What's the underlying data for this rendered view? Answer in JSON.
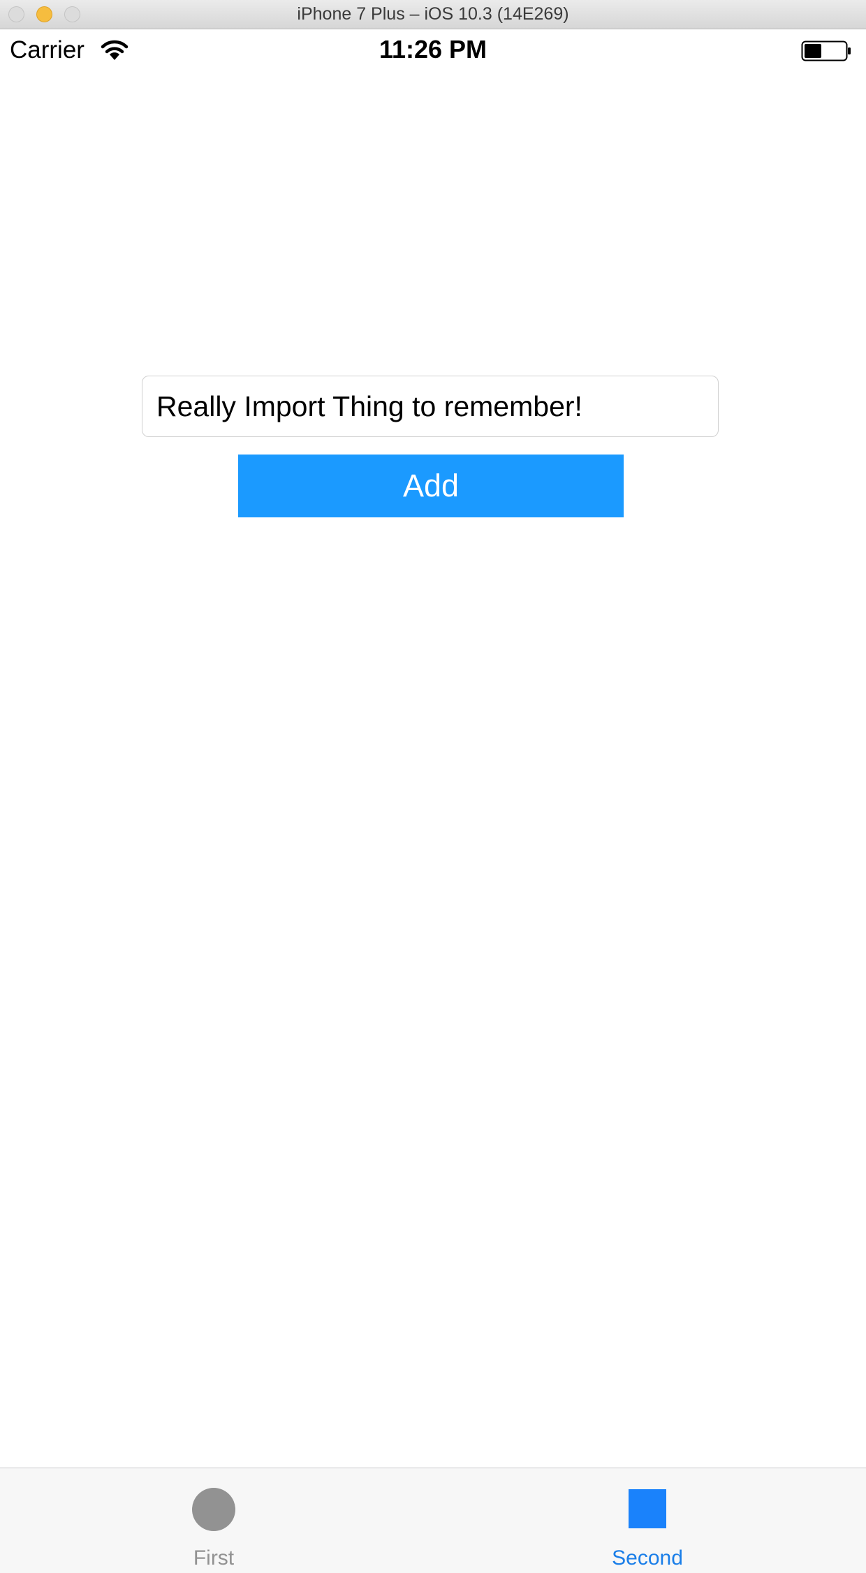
{
  "window": {
    "title": "iPhone 7 Plus – iOS 10.3 (14E269)"
  },
  "status_bar": {
    "carrier": "Carrier",
    "time": "11:26 PM"
  },
  "form": {
    "text_field_value": "Really Import Thing to remember!",
    "add_button_label": "Add",
    "accent_color": "#1b9aff"
  },
  "tab_bar": {
    "tabs": [
      {
        "label": "First",
        "icon": "circle-icon",
        "selected": false
      },
      {
        "label": "Second",
        "icon": "square-icon",
        "selected": true
      }
    ],
    "selected_color": "#1a7ee8",
    "unselected_color": "#929292"
  }
}
